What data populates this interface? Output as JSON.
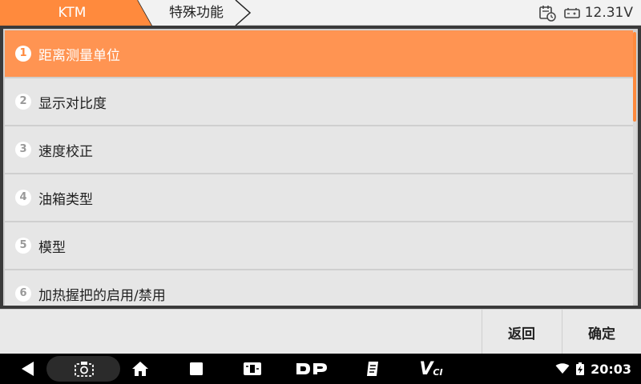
{
  "header": {
    "breadcrumb": [
      "KTM",
      "特殊功能"
    ],
    "voltage": "12.31V",
    "icons": [
      "calendar-clock-icon",
      "battery-icon"
    ]
  },
  "menu": {
    "items": [
      {
        "number": "1",
        "label": "距离测量单位"
      },
      {
        "number": "2",
        "label": "显示对比度"
      },
      {
        "number": "3",
        "label": "速度校正"
      },
      {
        "number": "4",
        "label": "油箱类型"
      },
      {
        "number": "5",
        "label": "模型"
      },
      {
        "number": "6",
        "label": "加热握把的启用/禁用"
      }
    ],
    "selected_index": 0,
    "accent_color": "#ff9452"
  },
  "actions": {
    "back_label": "返回",
    "confirm_label": "确定"
  },
  "system_bar": {
    "time": "20:03",
    "icons": [
      "back-icon",
      "screenshot-icon",
      "home-icon",
      "recents-icon",
      "vehicle-manager-icon",
      "dp-icon",
      "clipboard-icon",
      "vci-icon",
      "wifi-icon",
      "battery-charging-icon"
    ],
    "vci_label": "V",
    "vci_sub": "CI"
  }
}
